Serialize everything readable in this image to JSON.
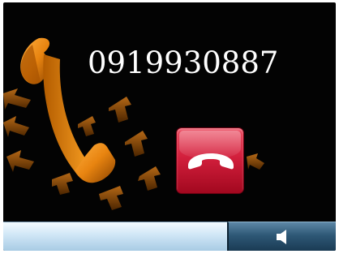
{
  "call": {
    "number": "0919930887"
  },
  "controls": {
    "end_call_icon": "hang-up-handset-icon",
    "speaker_icon": "speaker-icon"
  },
  "colors": {
    "background": "#030303",
    "handset_orange": "#f08a10",
    "end_call_red": "#d21f3c",
    "status_strip": "#cfe6f6",
    "speaker_button": "#2e5876"
  }
}
